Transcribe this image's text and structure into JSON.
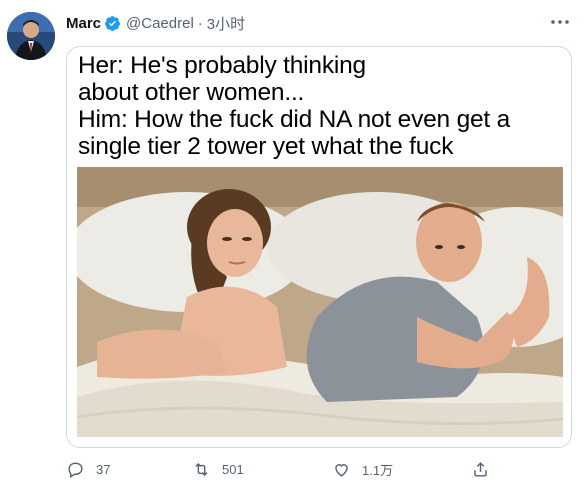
{
  "tweet": {
    "author": {
      "display_name": "Marc",
      "handle": "@Caedrel",
      "separator": "·",
      "time": "3小时",
      "avatar_icon": "avatar-photo"
    },
    "more_icon": "more-options-icon",
    "verified_color": "#1d9bf0",
    "media": {
      "caption_lines": [
        "Her: He's probably thinking",
        "about other women...",
        "Him: How the fuck did NA not even get a",
        "single tier 2 tower yet what the fuck"
      ],
      "image": "meme-photo-couple-in-bed"
    },
    "actions": {
      "reply_count": "37",
      "retweet_count": "501",
      "like_count": "1.1万",
      "share_icon": "share-icon"
    }
  }
}
